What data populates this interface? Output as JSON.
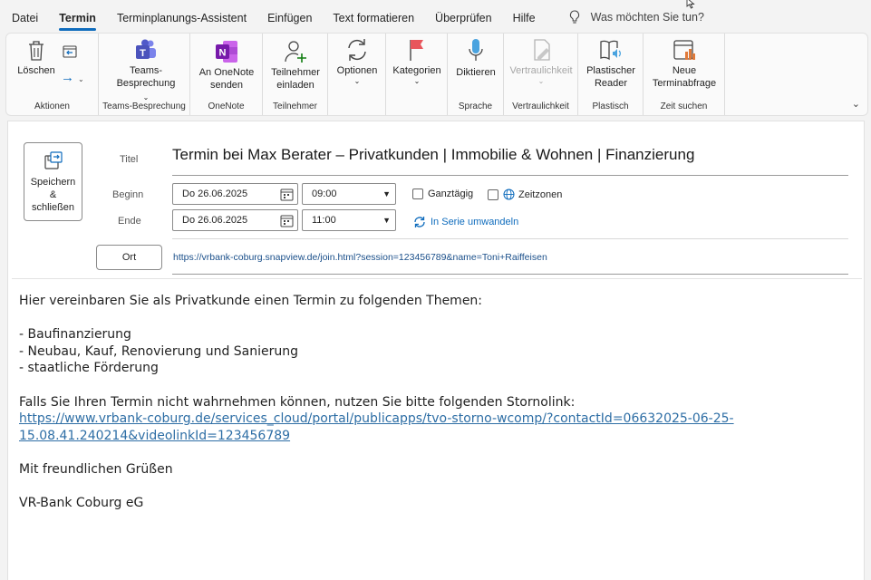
{
  "menu": {
    "items": [
      "Datei",
      "Termin",
      "Terminplanungs-Assistent",
      "Einfügen",
      "Text formatieren",
      "Überprüfen",
      "Hilfe"
    ],
    "tellme": "Was möchten Sie tun?"
  },
  "ribbon": {
    "aktionen": {
      "label": "Aktionen",
      "delete": "Löschen"
    },
    "teams": {
      "label": "Teams-Besprechung",
      "btn_line1": "Teams-",
      "btn_line2": "Besprechung"
    },
    "onenote": {
      "label": "OneNote",
      "btn_line1": "An OneNote",
      "btn_line2": "senden"
    },
    "teilnehmer": {
      "label": "Teilnehmer",
      "btn_line1": "Teilnehmer",
      "btn_line2": "einladen"
    },
    "optionen": {
      "btn": "Optionen"
    },
    "kategorien": {
      "btn": "Kategorien"
    },
    "sprache": {
      "label": "Sprache",
      "btn": "Diktieren"
    },
    "vertraulichkeit": {
      "label": "Vertraulichkeit",
      "btn": "Vertraulichkeit"
    },
    "plastisch": {
      "label": "Plastisch",
      "btn_line1": "Plastischer",
      "btn_line2": "Reader"
    },
    "zeit": {
      "label": "Zeit suchen",
      "btn_line1": "Neue",
      "btn_line2": "Terminabfrage"
    }
  },
  "form": {
    "save_line1": "Speichern",
    "save_line2": "&",
    "save_line3": "schließen",
    "title_label": "Titel",
    "title_value": "Termin bei Max Berater – Privatkunden | Immobilie & Wohnen | Finanzierung",
    "start_label": "Beginn",
    "start_date": "Do 26.06.2025",
    "start_time": "09:00",
    "end_label": "Ende",
    "end_date": "Do 26.06.2025",
    "end_time": "11:00",
    "allday": "Ganztägig",
    "timezones": "Zeitzonen",
    "series": "In Serie umwandeln",
    "location_button": "Ort",
    "location_value": "https://vrbank-coburg.snapview.de/join.html?session=123456789&name=Toni+Raiffeisen"
  },
  "body": {
    "intro": "Hier vereinbaren Sie als Privatkunde einen Termin zu folgenden Themen:",
    "topics": [
      "- Baufinanzierung",
      "- Neubau, Kauf, Renovierung und Sanierung",
      "- staatliche Förderung"
    ],
    "storno_text": "Falls Sie Ihren Termin nicht wahrnehmen können, nutzen Sie bitte folgenden Stornolink:",
    "storno_link_line1": "https://www.vrbank-coburg.de/services_cloud/portal/publicapps/tvo-storno-wcomp/?contactId=06632025-06-25-",
    "storno_link_line2": "15.08.41.240214&videolinkId=123456789",
    "greeting": "Mit freundlichen Grüßen",
    "signature": "VR-Bank Coburg eG"
  }
}
